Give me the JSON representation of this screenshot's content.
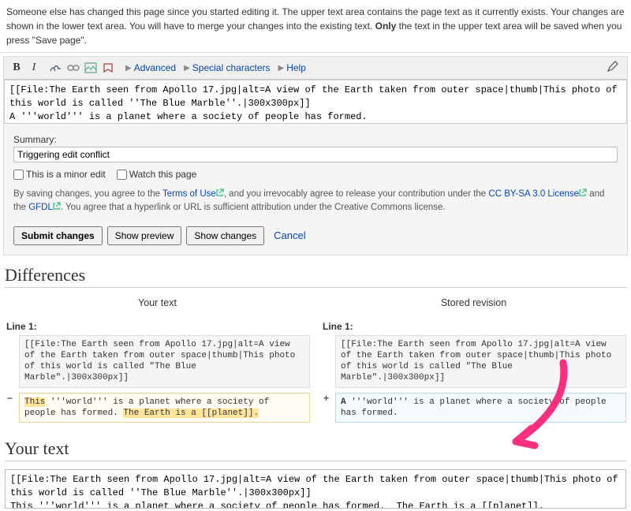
{
  "notice": {
    "line1_prefix": "Someone else has changed this page since you started editing it. The upper text area contains the page text as it currently exists. Your changes are shown in",
    "line2_prefix": "the lower text area. You will have to merge your changes into the existing text. ",
    "bold": "Only",
    "line2_suffix": " the text in the upper text area will be saved when you press \"Save page\"."
  },
  "toolbar": {
    "advanced": "Advanced",
    "special": "Special characters",
    "help": "Help"
  },
  "wikitext_upper": "[[File:The Earth seen from Apollo 17.jpg|alt=A view of the Earth taken from outer space|thumb|This photo of this world is called ''The Blue Marble''.|300x300px]]\nA '''world''' is a planet where a society of people has formed.",
  "summary": {
    "label": "Summary:",
    "value": "Triggering edit conflict"
  },
  "checks": {
    "minor": "This is a minor edit",
    "watch": "Watch this page"
  },
  "legal": {
    "pre": "By saving changes, you agree to the ",
    "tou": "Terms of Use",
    "mid1": ", and you irrevocably agree to release your contribution under the ",
    "cc": "CC BY-SA 3.0 License",
    "mid2": " and the ",
    "gfdl": "GFDL",
    "tail": ". You agree that a hyperlink or URL is sufficient attribution under the Creative Commons license."
  },
  "actions": {
    "submit": "Submit changes",
    "preview": "Show preview",
    "changes": "Show changes",
    "cancel": "Cancel"
  },
  "diff": {
    "heading": "Differences",
    "left_title": "Your text",
    "right_title": "Stored revision",
    "line_label": "Line 1:",
    "ctx": "[[File:The Earth seen from Apollo 17.jpg|alt=A view of the Earth taken from outer space|thumb|This photo of this world is called \"The Blue Marble\".|300x300px]]",
    "left_row2_a": "This",
    "left_row2_b": " '''world''' is a planet where a society of people has formed. ",
    "left_row2_c": "The Earth is a [[planet]].",
    "right_row2_a": "A",
    "right_row2_b": " '''world''' is a planet where a society of people has formed.",
    "minus": "−",
    "plus": "+"
  },
  "your_text": {
    "heading": "Your text",
    "content": "[[File:The Earth seen from Apollo 17.jpg|alt=A view of the Earth taken from outer space|thumb|This photo of this world is called ''The Blue Marble''.|300x300px]]\nThis '''world''' is a planet where a society of people has formed.  The Earth is a [[planet]]."
  }
}
